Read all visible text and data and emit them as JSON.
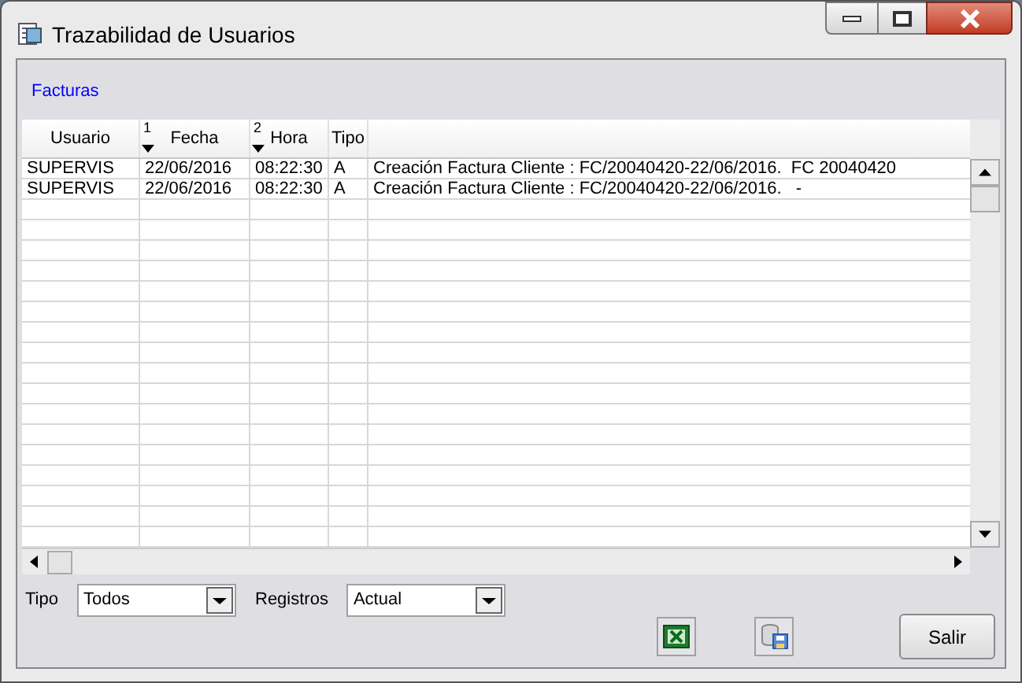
{
  "window": {
    "title": "Trazabilidad de Usuarios"
  },
  "section_label": "Facturas",
  "table": {
    "columns": [
      {
        "label": "Usuario"
      },
      {
        "label": "Fecha",
        "sort_order": "1"
      },
      {
        "label": "Hora",
        "sort_order": "2"
      },
      {
        "label": "Tipo"
      }
    ],
    "rows": [
      {
        "usuario": "SUPERVIS",
        "fecha": "22/06/2016",
        "hora": "08:22:30",
        "tipo": "A",
        "descripcion": "Creación Factura Cliente : FC/20040420-22/06/2016.  FC 20040420"
      },
      {
        "usuario": "SUPERVIS",
        "fecha": "22/06/2016",
        "hora": "08:22:30",
        "tipo": "A",
        "descripcion": "Creación Factura Cliente : FC/20040420-22/06/2016.   -"
      }
    ]
  },
  "filters": [
    {
      "label": "Tipo",
      "value": "Todos"
    },
    {
      "label": "Registros",
      "value": "Actual"
    }
  ],
  "buttons": [
    {
      "kind": "excel"
    },
    {
      "kind": "save"
    },
    {
      "kind": "text",
      "label": "Salir"
    }
  ]
}
